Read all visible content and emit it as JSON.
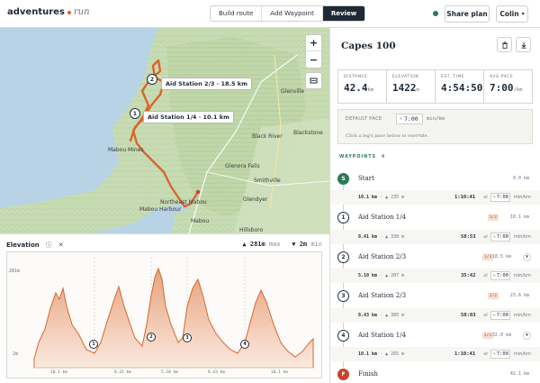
{
  "app": {
    "logo_main": "adventures",
    "logo_sub": "run"
  },
  "topbar": {
    "modes": [
      {
        "label": "Build route",
        "active": false
      },
      {
        "label": "Add Waypoint",
        "active": false
      },
      {
        "label": "Review",
        "active": true
      }
    ],
    "share_label": "Share plan",
    "user_label": "Colin"
  },
  "map": {
    "places": [
      "Glenville",
      "Black River",
      "Blackstone",
      "Mabou Mines",
      "Glenora Falls",
      "Smithville",
      "Glendyer",
      "Northeast Mabou",
      "Mabou Harbour",
      "Mabou",
      "Hillsboro"
    ],
    "waypoint_labels": [
      "Aid Station 2/3 · 18.5 km",
      "Aid Station 1/4 · 10.1 km"
    ],
    "marker_numbers": [
      "2",
      "1"
    ],
    "zoom_in": "+",
    "zoom_out": "−",
    "info": "i"
  },
  "elevation": {
    "title": "Elevation",
    "max_value": "281m",
    "max_label": "max",
    "min_value": "2m",
    "min_label": "min",
    "y_top": "281m",
    "y_bottom": "2m",
    "x_ticks": [
      "10.1 km",
      "8.41 km",
      "5.10 km",
      "8.43 km",
      "10.1 km"
    ],
    "markers": [
      "1",
      "2",
      "3",
      "4"
    ]
  },
  "plan": {
    "title": "Capes 100",
    "stats": [
      {
        "label": "DISTANCE",
        "value": "42.4",
        "unit": "km"
      },
      {
        "label": "ELEVATION",
        "value": "1422",
        "unit": "m"
      },
      {
        "label": "EST. TIME",
        "value": "4:54:50",
        "unit": ""
      },
      {
        "label": "AVG PACE",
        "value": "7:00",
        "unit": "/km"
      }
    ],
    "default_pace_label": "DEFAULT PACE",
    "default_pace_value": "7:00",
    "default_pace_unit": "min/km",
    "pace_hint": "Click a leg's pace below to override.",
    "waypoints_label": "WAYPOINTS",
    "waypoints_count": "4"
  },
  "waypoints": [
    {
      "marker": "S",
      "name": "Start",
      "dist": "0.0 km",
      "badge": "",
      "kind": "start"
    },
    {
      "marker": "1",
      "name": "Aid Station 1/4",
      "dist": "10.1 km",
      "badge": "1/2",
      "kind": "normal"
    },
    {
      "marker": "2",
      "name": "Aid Station 2/3",
      "dist": "18.5 km",
      "badge": "1/3",
      "kind": "normal"
    },
    {
      "marker": "3",
      "name": "Aid Station 2/3",
      "dist": "23.6 km",
      "badge": "2/2",
      "kind": "normal"
    },
    {
      "marker": "4",
      "name": "Aid Station 1/4",
      "dist": "32.0 km",
      "badge": "2/3",
      "kind": "normal"
    },
    {
      "marker": "F",
      "name": "Finish",
      "dist": "42.1 km",
      "badge": "",
      "kind": "finish"
    }
  ],
  "legs": [
    {
      "dist": "10.1 km",
      "gain": "▲ 235 m",
      "time": "1:10:41",
      "at": "at",
      "pace": "7:00",
      "unit": "min/km"
    },
    {
      "dist": "8.41 km",
      "gain": "▲ 330 m",
      "time": "58:53",
      "at": "at",
      "pace": "7:00",
      "unit": "min/km"
    },
    {
      "dist": "5.10 km",
      "gain": "▲ 207 m",
      "time": "35:42",
      "at": "at",
      "pace": "7:00",
      "unit": "min/km"
    },
    {
      "dist": "8.43 km",
      "gain": "▲ 385 m",
      "time": "58:03",
      "at": "at",
      "pace": "7:00",
      "unit": "min/km"
    },
    {
      "dist": "10.1 km",
      "gain": "▲ 265 m",
      "time": "1:10:41",
      "at": "at",
      "pace": "7:00",
      "unit": "min/km"
    }
  ],
  "colors": {
    "accent": "#d9652b",
    "route": "#d9652b",
    "start": "#2c7a55",
    "finish": "#c8442c",
    "dark": "#1f2a36"
  }
}
